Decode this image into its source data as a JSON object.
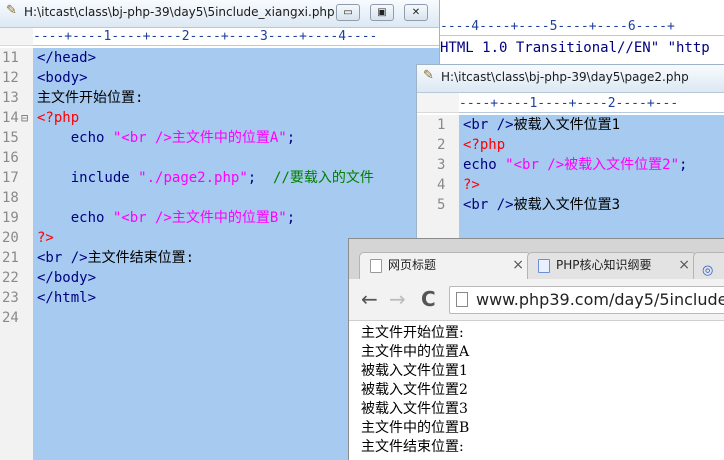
{
  "editor_main": {
    "title": "H:\\itcast\\class\\bj-php-39\\day5\\5include_xiangxi.php",
    "ruler": "----+----1----+----2----+----3----+----4----",
    "line_numbers": [
      "11",
      "12",
      "13",
      "14",
      "15",
      "16",
      "17",
      "18",
      "19",
      "20",
      "21",
      "22",
      "23",
      "24"
    ],
    "lines": [
      {
        "t": "tag",
        "text": "</head>"
      },
      {
        "t": "tag",
        "text": "<body>"
      },
      {
        "t": "text",
        "text": "主文件开始位置:"
      },
      {
        "t": "php",
        "text": "<?php"
      },
      {
        "t": "echo",
        "kw": "echo",
        "str": "\"<br />主文件中的位置A\"",
        "end": ";"
      },
      {
        "t": "blank",
        "text": ""
      },
      {
        "t": "include",
        "kw": "include",
        "str": "\"./page2.php\"",
        "end": ";",
        "comment": "//要载入的文件"
      },
      {
        "t": "blank",
        "text": ""
      },
      {
        "t": "echo",
        "kw": "echo",
        "str": "\"<br />主文件中的位置B\"",
        "end": ";"
      },
      {
        "t": "php",
        "text": "?>"
      },
      {
        "t": "mixed",
        "tag": "<br />",
        "text": "主文件结束位置:"
      },
      {
        "t": "tag",
        "text": "</body>"
      },
      {
        "t": "tag",
        "text": "</html>"
      },
      {
        "t": "blank",
        "text": ""
      }
    ],
    "buttons": {
      "minimize": "▭",
      "restore": "▣",
      "close": "✕"
    }
  },
  "editor_back": {
    "ruler": "----4----+----5----+----6----+",
    "line": "HTML 1.0 Transitional//EN\" \"http"
  },
  "editor_page2": {
    "title": "H:\\itcast\\class\\bj-php-39\\day5\\page2.php",
    "ruler": "----+----1----+----2----+---",
    "line_numbers": [
      "1",
      "2",
      "3",
      "4",
      "5"
    ],
    "lines": [
      {
        "t": "mixed",
        "tag": "<br />",
        "text": "被载入文件位置1"
      },
      {
        "t": "php",
        "text": "<?php"
      },
      {
        "t": "echo",
        "kw": "echo",
        "str": "\"<br />被载入文件位置2\"",
        "end": ";"
      },
      {
        "t": "php",
        "text": "?>"
      },
      {
        "t": "mixed",
        "tag": "<br />",
        "text": "被载入文件位置3"
      }
    ]
  },
  "browser": {
    "tabs": [
      {
        "label": "网页标题",
        "close": "×"
      },
      {
        "label": "PHP核心知识纲要",
        "close": "×"
      }
    ],
    "url": "www.php39.com/day5/5include_",
    "nav": {
      "back": "←",
      "forward": "→",
      "reload": "C"
    },
    "output_lines": [
      "主文件开始位置:",
      "主文件中的位置A",
      "被载入文件位置1",
      "被载入文件位置2",
      "被载入文件位置3",
      "主文件中的位置B",
      "主文件结束位置:"
    ]
  }
}
